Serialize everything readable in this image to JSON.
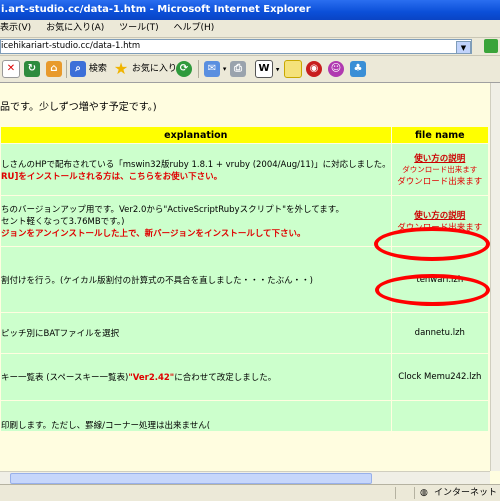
{
  "window": {
    "title": "i.art-studio.cc/data-1.htm - Microsoft Internet Explorer"
  },
  "menu": {
    "items": [
      "表示(V)",
      "お気に入り(A)",
      "ツール(T)",
      "ヘルプ(H)"
    ]
  },
  "address": {
    "value": "icehikariart-studio.cc/data-1.htm"
  },
  "toolbar": {
    "search_label": "検索",
    "favorites_label": "お気に入り"
  },
  "page": {
    "intro": "品です。少しずつ増やす予定です。)",
    "table": {
      "headers": {
        "explanation": "explanation",
        "file_name": "file name"
      },
      "rows": [
        {
          "lines": [
            {
              "text": "しさんのHPで配布されている「mswin32版ruby 1.8.1 + vruby (2004/Aug/11)」に対応しました。",
              "style": "normal"
            },
            {
              "text": "RU]をインストールされる方は、こちらをお使い下さい。",
              "style": "red"
            }
          ],
          "file": {
            "link": "使い方の説明",
            "sub1": "ダウンロード出来ます",
            "sub2": "ダウンロード出来ます"
          }
        },
        {
          "lines": [
            {
              "text": "ちのバージョンアップ用です。Ver2.0から\"ActiveScriptRubyスクリプト\"を外してます。",
              "style": "normal"
            },
            {
              "text": "セント軽くなって3.76MBです。)",
              "style": "normal"
            },
            {
              "text": "ジョンをアンインストールした上で、新バージョンをインストールして下さい。",
              "style": "red"
            }
          ],
          "file": {
            "link": "使い方の説明",
            "sub1": "ダウンロード出来ます"
          }
        },
        {
          "lines": [
            {
              "text": "割付けを行う。(ケイカル版割付の計算式の不具合を直しました・・・たぶん・・)",
              "style": "normal"
            }
          ],
          "file": {
            "name": "tenwari.lzh"
          }
        },
        {
          "lines": [
            {
              "text": "ピッチ別にBATファイルを選択",
              "style": "normal"
            }
          ],
          "file": {
            "name": "dannetu.lzh"
          }
        },
        {
          "lines": [
            {
              "text": "キー一覧表 (スペースキー一覧表)\"Ver2.42\"に合わせて改定しました。",
              "style": "mixed",
              "pre": "キー一覧表 (スペースキー一覧表)",
              "red": "\"Ver2.42\"",
              "post": "に合わせて改定しました。"
            }
          ],
          "file": {
            "name": "Clock Memu242.lzh"
          }
        },
        {
          "lines": [
            {
              "text": "印刷します。ただし、罫線/コーナー処理は出来ません(",
              "style": "normal"
            }
          ],
          "file": {
            "name": ""
          }
        }
      ]
    }
  },
  "status": {
    "zone": "インターネット"
  },
  "colors": {
    "header_yellow": "#ffff00",
    "row_green": "#ccffcc",
    "page_bg": "#fffde0",
    "annotation_red": "#ff0000"
  }
}
